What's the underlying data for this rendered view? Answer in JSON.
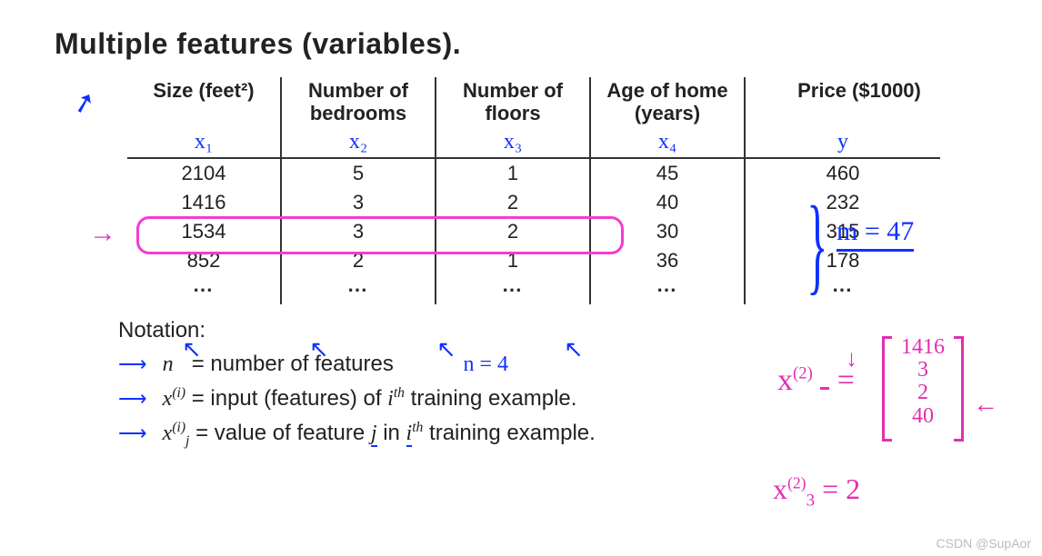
{
  "title": "Multiple features (variables).",
  "table": {
    "headers": {
      "c1a": "Size (feet²)",
      "c2a": "Number of",
      "c2b": "bedrooms",
      "c3a": "Number of",
      "c3b": "floors",
      "c4a": "Age of home",
      "c4b": "(years)",
      "c5a": "Price ($1000)"
    },
    "vars": {
      "c1": "x₁",
      "c2": "x₂",
      "c3": "x₃",
      "c4": "x₄",
      "c5": "y"
    },
    "rows": [
      {
        "c1": "2104",
        "c2": "5",
        "c3": "1",
        "c4": "45",
        "c5": "460"
      },
      {
        "c1": "1416",
        "c2": "3",
        "c3": "2",
        "c4": "40",
        "c5": "232"
      },
      {
        "c1": "1534",
        "c2": "3",
        "c3": "2",
        "c4": "30",
        "c5": "315"
      },
      {
        "c1": "852",
        "c2": "2",
        "c3": "1",
        "c4": "36",
        "c5": "178"
      }
    ],
    "ellipsis": "⋯"
  },
  "arrows_under_cols": "↖",
  "notation": {
    "heading": "Notation:",
    "n_line_lhs": "n",
    "n_line_rhs": "= number of features",
    "n_equals": "n = 4",
    "xi_line_lhs": "x",
    "xi_line_sup": "(i)",
    "xi_line_rhs_a": "= input (features) of ",
    "xi_line_rhs_b": "i",
    "xi_line_rhs_c": "th",
    "xi_line_rhs_d": " training example.",
    "xij_line_lhs": "x",
    "xij_line_sub": "j",
    "xij_line_sup": "(i)",
    "xij_line_rhs_a": "= value of feature ",
    "xij_line_rhs_b": "j",
    "xij_line_rhs_c": " in  ",
    "xij_line_rhs_d": "i",
    "xij_line_rhs_e": "th",
    "xij_line_rhs_f": " training example."
  },
  "annotations": {
    "m_equals": "m = 47",
    "x2_vec_lhs": "x",
    "x2_vec_sup": "(2)",
    "x2_vec_eq": "=",
    "x2_vec_values": [
      "1416",
      "3",
      "2",
      "40"
    ],
    "x32_lhs": "x",
    "x32_sup": "(2)",
    "x32_sub": "3",
    "x32_rhs": "= 2",
    "left_arrow": "←",
    "down_arrow": "↓",
    "curly_brace": "}"
  },
  "watermark": "CSDN @SupAor",
  "chart_data": {
    "type": "table",
    "title": "Multiple features (variables).",
    "columns": [
      "Size (feet²)",
      "Number of bedrooms",
      "Number of floors",
      "Age of home (years)",
      "Price ($1000)"
    ],
    "feature_symbols": [
      "x1",
      "x2",
      "x3",
      "x4",
      "y"
    ],
    "rows": [
      [
        2104,
        5,
        1,
        45,
        460
      ],
      [
        1416,
        3,
        2,
        40,
        232
      ],
      [
        1534,
        3,
        2,
        30,
        315
      ],
      [
        852,
        2,
        1,
        36,
        178
      ]
    ],
    "n_features": 4,
    "m_examples": 47,
    "example_vector_x_2": [
      1416,
      3,
      2,
      40
    ],
    "example_scalar_x_2_3": 2,
    "notation": [
      "n = number of features",
      "x^(i) = input (features) of i-th training example.",
      "x_j^(i) = value of feature j in i-th training example."
    ]
  }
}
